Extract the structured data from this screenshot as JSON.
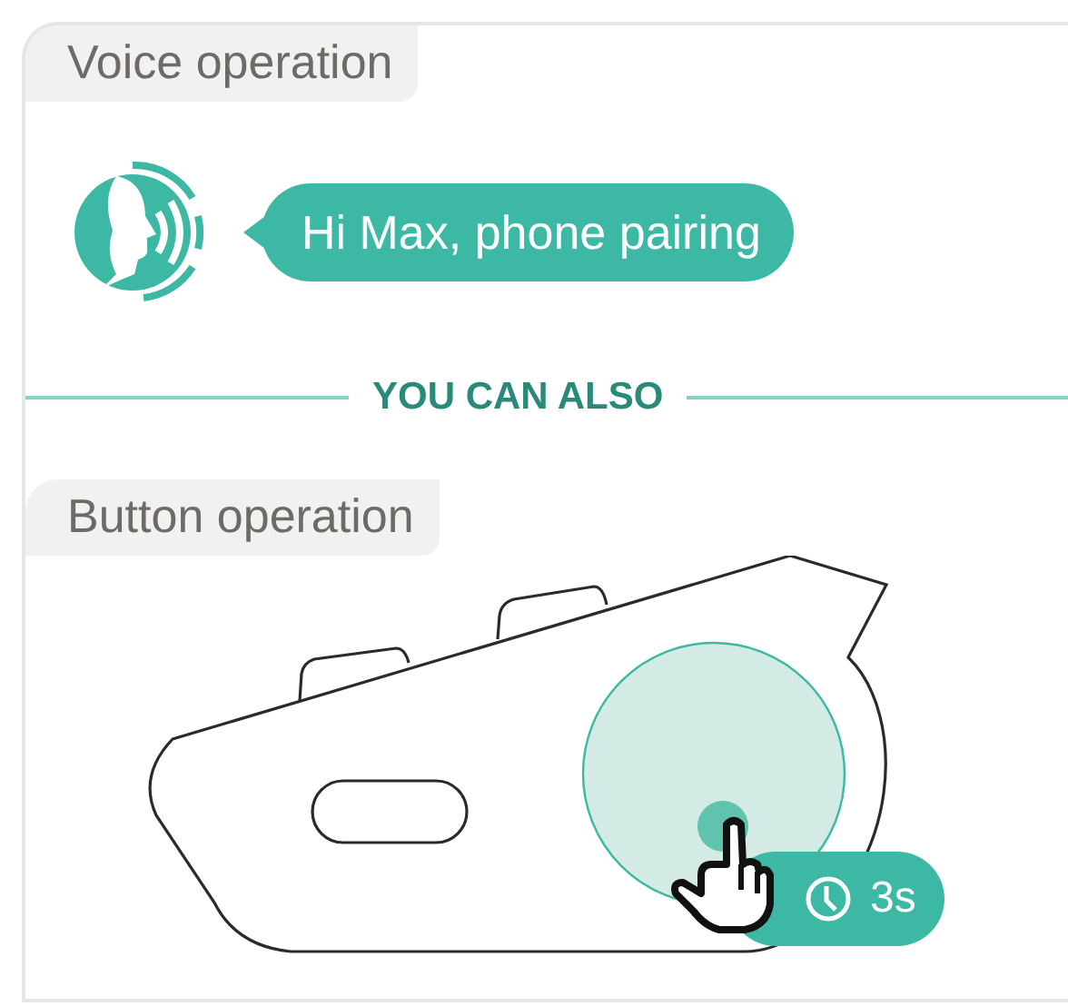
{
  "voice_operation": {
    "title": "Voice operation",
    "command": "Hi Max, phone pairing"
  },
  "divider": {
    "label": "YOU CAN ALSO"
  },
  "button_operation": {
    "title": "Button operation",
    "hold_time": "3s"
  }
}
